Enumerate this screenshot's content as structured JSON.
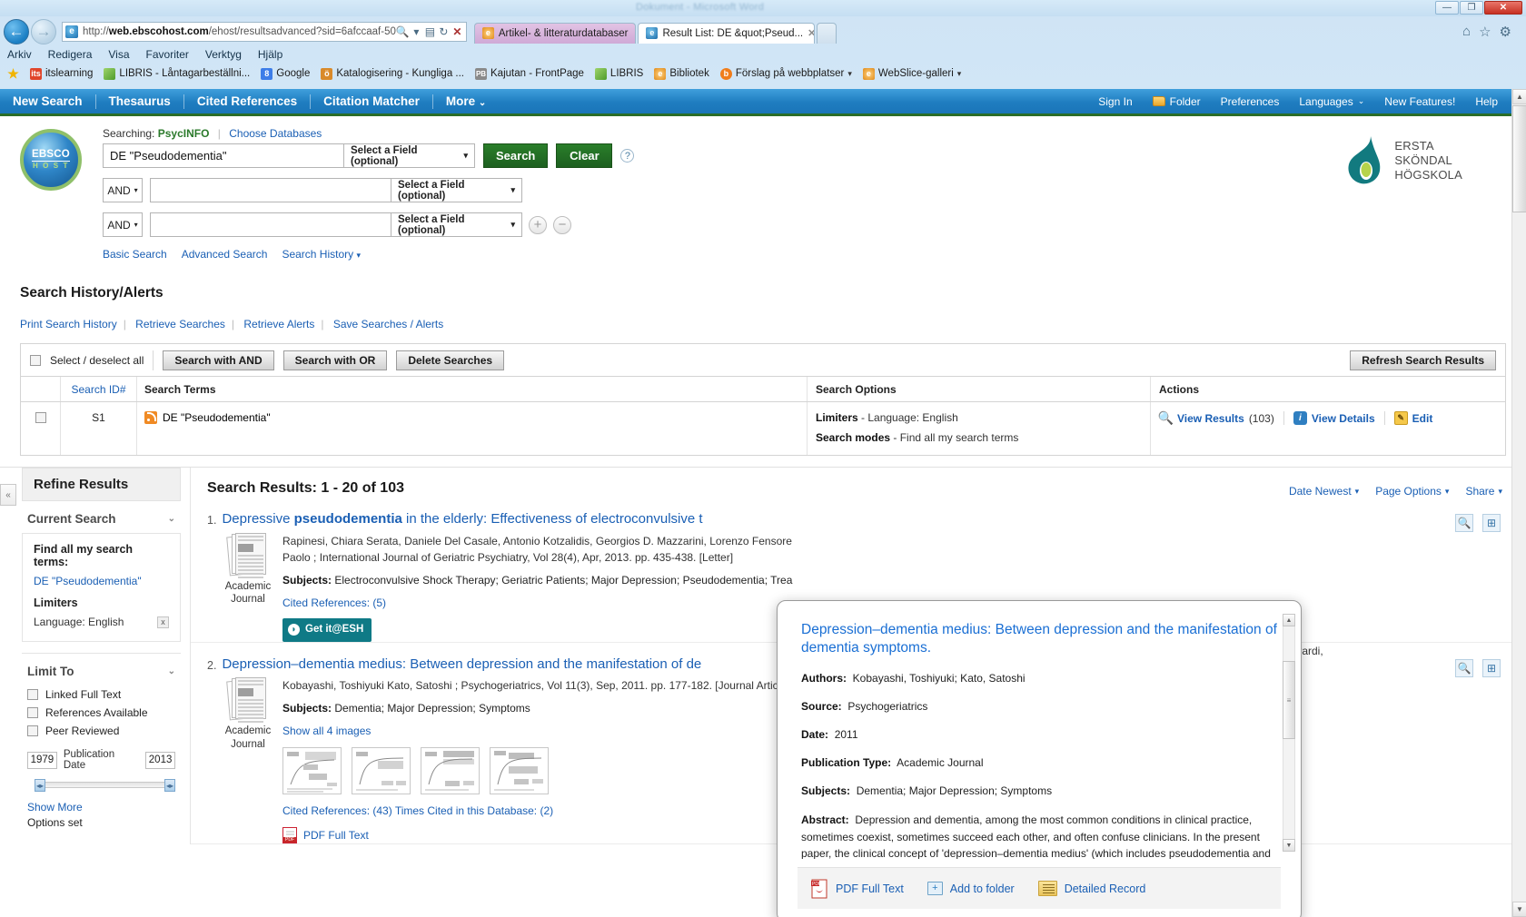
{
  "window": {
    "title": "Dokument - Microsoft Word",
    "minimize": "—",
    "maximize": "❐",
    "close": "✕"
  },
  "browser": {
    "url_prefix": "http://",
    "url_bold": "web.ebscohost.com",
    "url_suffix": "/ehost/resultsadvanced?sid=6afccaaf-50",
    "search_icon": "search-icon",
    "compat_icon": "compatibility-view-icon",
    "refresh_icon": "↻",
    "stop_icon": "✕",
    "tabs": [
      {
        "label": "Artikel- & litteraturdatabaser",
        "active": false
      },
      {
        "label": "Result List: DE &quot;Pseud...",
        "active": true
      }
    ],
    "newtab_label": "",
    "chrome_icons": [
      "home-icon",
      "favorites-star-icon",
      "tools-gear-icon"
    ],
    "menus": [
      "Arkiv",
      "Redigera",
      "Visa",
      "Favoriter",
      "Verktyg",
      "Hjälp"
    ],
    "favorites": [
      {
        "label": "itslearning",
        "icon": "its-icon"
      },
      {
        "label": "LIBRIS - Låntagarbeställni...",
        "icon": "leaf-icon"
      },
      {
        "label": "Google",
        "icon": "google-icon"
      },
      {
        "label": "Katalogisering - Kungliga ...",
        "icon": "katalog-icon"
      },
      {
        "label": "Kajutan - FrontPage",
        "icon": "pb-icon"
      },
      {
        "label": "LIBRIS",
        "icon": "leaf-icon"
      },
      {
        "label": "Bibliotek",
        "icon": "ie-icon"
      },
      {
        "label": "Förslag på webbplatser",
        "icon": "o-icon",
        "dropdown": true
      },
      {
        "label": "WebSlice-galleri",
        "icon": "ie-icon",
        "dropdown": true
      }
    ]
  },
  "ebsco_nav": {
    "left": [
      "New Search",
      "Thesaurus",
      "Cited References",
      "Citation Matcher"
    ],
    "more_label": "More",
    "right": [
      "Sign In",
      "Folder",
      "Preferences",
      "Languages",
      "New Features!",
      "Help"
    ]
  },
  "logo": {
    "ebsco_word": "EBSCO",
    "ebsco_host": "H O S T",
    "esh_line1": "ERSTA",
    "esh_line2": "SKÖNDAL",
    "esh_line3": "HÖGSKOLA"
  },
  "search_form": {
    "searching_label": "Searching:",
    "database": "PsycINFO",
    "choose_databases": "Choose Databases",
    "query_value": "DE \"Pseudodementia\"",
    "field_placeholder": "Select a Field (optional)",
    "bool_and": "AND",
    "row2_value": "",
    "row3_value": "",
    "search_button": "Search",
    "clear_button": "Clear",
    "help_icon": "?",
    "add_row": "+",
    "remove_row": "−",
    "mode_links": [
      "Basic Search",
      "Advanced Search",
      "Search History"
    ]
  },
  "search_history": {
    "title": "Search History/Alerts",
    "links": [
      "Print Search History",
      "Retrieve Searches",
      "Retrieve Alerts",
      "Save Searches / Alerts"
    ],
    "select_all": "Select / deselect all",
    "buttons": [
      "Search with AND",
      "Search with OR",
      "Delete Searches"
    ],
    "refresh_button": "Refresh Search Results",
    "columns": [
      "",
      "Search ID#",
      "Search Terms",
      "Search Options",
      "Actions"
    ],
    "rows": [
      {
        "id": "S1",
        "terms": "DE \"Pseudodementia\"",
        "limiters_label": "Limiters",
        "limiters_value": "- Language: English",
        "modes_label": "Search modes",
        "modes_value": "- Find all my search terms",
        "actions": [
          {
            "label": "View Results",
            "count": "(103)",
            "icon": "magnifier-icon"
          },
          {
            "label": "View Details",
            "icon": "info-icon"
          },
          {
            "label": "Edit",
            "icon": "pencil-icon"
          }
        ]
      }
    ]
  },
  "refine": {
    "header": "Refine Results",
    "current_search_label": "Current Search",
    "find_all_label": "Find all my search terms:",
    "find_all_value": "DE \"Pseudodementia\"",
    "limiters_label": "Limiters",
    "limiter_value": "Language: English",
    "limiter_remove": "x",
    "limit_to_label": "Limit To",
    "checkboxes": [
      "Linked Full Text",
      "References Available",
      "Peer Reviewed"
    ],
    "date_from": "1979",
    "date_label": "Publication Date",
    "date_to": "2013",
    "show_more": "Show More",
    "options_set": "Options set",
    "collapse_icon": "«"
  },
  "results": {
    "heading_label": "Search Results:",
    "heading_range": "1 - 20 of 103",
    "tools": [
      {
        "label": "Date Newest",
        "caret": true
      },
      {
        "label": "Page Options",
        "caret": true
      },
      {
        "label": "Share",
        "caret": true
      }
    ],
    "items": [
      {
        "num": "1.",
        "title_pre": "Depressive ",
        "title_bold": "pseudodementia",
        "title_post": " in the elderly: Effectiveness of electroconvulsive t",
        "doc_type_line1": "Academic",
        "doc_type_line2": "Journal",
        "authors": "Rapinesi, Chiara Serata, Daniele Del Casale, Antonio Kotzalidis, Georgios D. Mazzarini, Lorenzo Fensore",
        "authors2": "Paolo ; International Journal of Geriatric Psychiatry, Vol 28(4), Apr, 2013. pp. 435-438. [Letter]",
        "subjects_label": "Subjects:",
        "subjects": "Electroconvulsive Shock Therapy; Geriatric Patients; Major Depression; Pseudodementia; Trea",
        "cited_refs": "Cited References: (5)",
        "gotit": "Get it@ESH",
        "overflow_right": "rto Girardi,"
      },
      {
        "num": "2.",
        "title_pre": "",
        "title_bold": "",
        "title_post": "Depression–dementia medius: Between depression and the manifestation of de",
        "doc_type_line1": "Academic",
        "doc_type_line2": "Journal",
        "authors": "Kobayashi, Toshiyuki Kato, Satoshi ; Psychogeriatrics, Vol 11(3), Sep, 2011. pp. 177-182. [Journal Article",
        "subjects_label": "Subjects:",
        "subjects": "Dementia; Major Depression; Symptoms",
        "show_images": "Show all 4 images",
        "cited_refs": "Cited References: (43) Times Cited in this Database: (2)",
        "pdf_link": "PDF Full Text"
      }
    ]
  },
  "preview_popup": {
    "title": "Depression–dementia medius: Between depression and the manifestation of dementia symptoms.",
    "fields": [
      {
        "label": "Authors:",
        "value": "Kobayashi, Toshiyuki; Kato, Satoshi"
      },
      {
        "label": "Source:",
        "value": "Psychogeriatrics"
      },
      {
        "label": "Date:",
        "value": "2011"
      },
      {
        "label": "Publication Type:",
        "value": "Academic Journal"
      },
      {
        "label": "Subjects:",
        "value": "Dementia; Major Depression; Symptoms"
      }
    ],
    "abstract_label": "Abstract:",
    "abstract": "Depression and dementia, among the most common conditions in clinical practice, sometimes coexist, sometimes succeed each other, and often confuse clinicians. In the present paper, the clinical concept of 'depression–dementia medius' (which includes pseudodementia and depression in Alzheimer's disease as exemplars) is proposed, in reference to Janet's concept of psychological",
    "footer": [
      {
        "label": "PDF Full Text",
        "icon": "pdf-icon"
      },
      {
        "label": "Add to folder",
        "icon": "folder-plus-icon"
      },
      {
        "label": "Detailed Record",
        "icon": "record-icon"
      }
    ]
  },
  "colors": {
    "ebsco_blue": "#1f7dc0",
    "link_blue": "#1a5fb4",
    "green": "#2b7a2b",
    "teal": "#0f7a86",
    "esh_teal": "#127a7f"
  }
}
